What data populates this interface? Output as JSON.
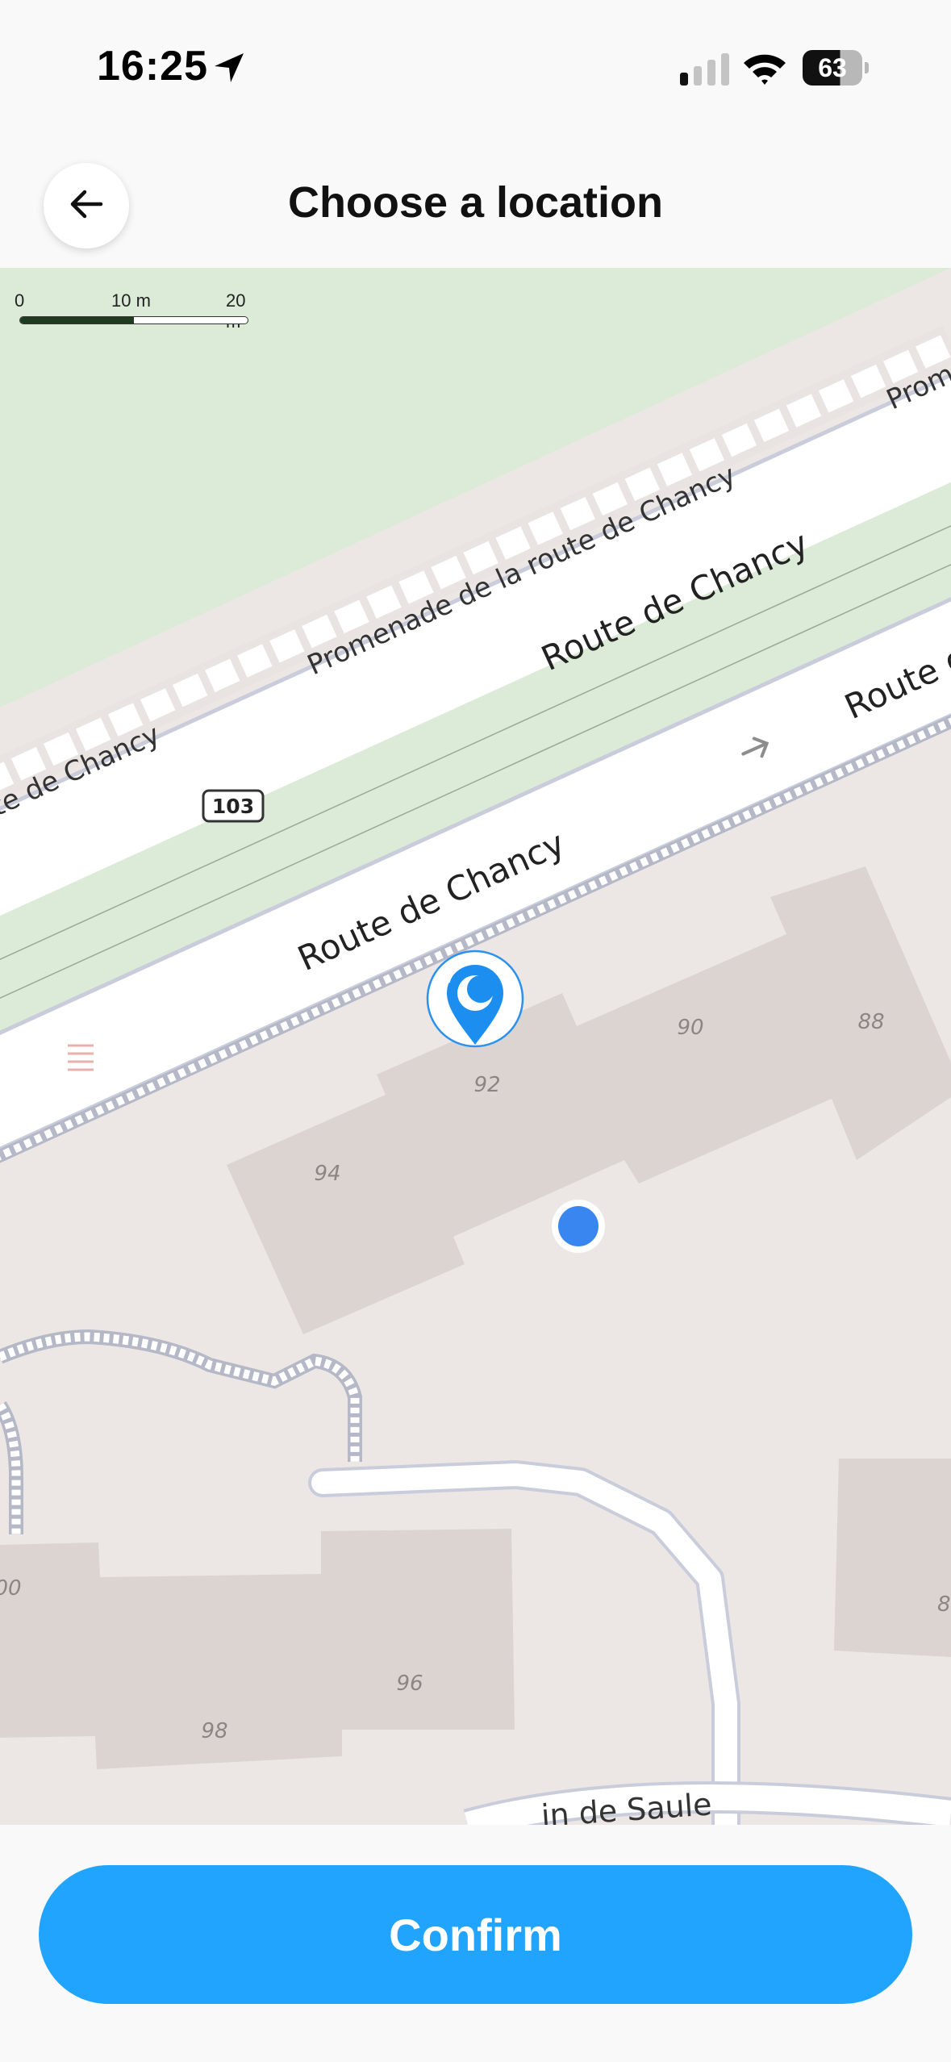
{
  "status": {
    "time": "16:25",
    "battery": "63",
    "icons": [
      "location-arrow-icon",
      "signal-icon",
      "wifi-icon",
      "battery-icon"
    ]
  },
  "header": {
    "title": "Choose a location",
    "back_icon": "arrow-left-icon"
  },
  "map": {
    "scale": {
      "labels": [
        "0",
        "10 m",
        "20 m"
      ],
      "fill_fraction": 0.5
    },
    "roads": {
      "promenade": "Promenade de la route de Chancy",
      "promenade_left": "te de Chancy",
      "promenade_right": "Prom",
      "route_upper": "Route de Chancy",
      "route_lower": "Route de Chancy",
      "route_lower_right": "Route d",
      "route_number": "103",
      "chemin": "in de Saule"
    },
    "house_numbers": [
      "92",
      "90",
      "88",
      "94",
      "00",
      "96",
      "98",
      "8("
    ],
    "colors": {
      "land": "#ece7e4",
      "park": "#dcebd7",
      "road": "#ffffff",
      "building": "#dbd4d1",
      "user_dot": "#3a86f1",
      "pin": "#1c8ef0"
    },
    "icons": [
      "map-pin-icon",
      "current-location-dot",
      "direction-arrow-icon"
    ]
  },
  "footer": {
    "confirm_label": "Confirm"
  }
}
